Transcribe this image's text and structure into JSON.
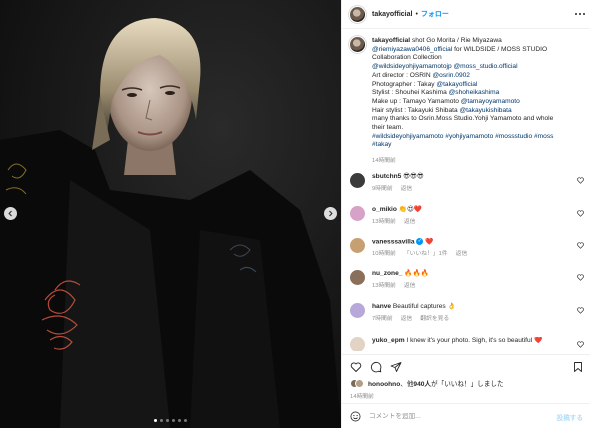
{
  "header": {
    "username": "takayofficial",
    "separator": "•",
    "follow_label": "フォロー"
  },
  "caption": {
    "username": "takayofficial",
    "lines": [
      "shot Go Morita / Rie Miyazawa",
      "@riemiyazawa0406_official",
      " for WILDSIDE / MOSS STUDIO",
      "Collaboration Collection",
      "@wildsideyohjiyamamotojp @moss_studio.official",
      "Art director : OSRIN ",
      "@osrin.0902",
      "Photographer : Takay ",
      "@takayofficial",
      "Stylist : Shouhei Kashima ",
      "@shoheikashima",
      "Make up : Tamayo Yamamoto ",
      "@tamayoyamamoto",
      "Hair stylist : Takayuki Shibata ",
      "@takayukishibata",
      "many thanks to Osrin.Moss Studio.Yohji Yamamoto and whole",
      "their team.",
      "#wildsideyohjiyamamoto #yohjiyamamoto #mossstudio #moss",
      "#takay"
    ],
    "time": "14時間前"
  },
  "comments": [
    {
      "username": "sbutchn5",
      "text": "😎😎😎",
      "time": "9時間前",
      "reply": "返信",
      "likes": "",
      "translate": "",
      "avatar_color": "#3b3b3b"
    },
    {
      "username": "o_mikio",
      "text": "👏😍❤️",
      "time": "13時間前",
      "reply": "返信",
      "likes": "",
      "translate": "",
      "avatar_color": "#d6a2c8"
    },
    {
      "username": "vanesssavilla",
      "text": "❤️",
      "time": "10時間前",
      "reply": "返信",
      "likes": "「いいね！」1件",
      "translate": "",
      "avatar_color": "#c7a072",
      "verified": "✓"
    },
    {
      "username": "nu_zone_",
      "text": "🔥🔥🔥",
      "time": "13時間前",
      "reply": "返信",
      "likes": "",
      "translate": "",
      "avatar_color": "#8a6f5a"
    },
    {
      "username": "hanve",
      "text": "Beautiful captures 👌",
      "time": "7時間前",
      "reply": "返信",
      "likes": "",
      "translate": "翻訳を見る",
      "avatar_color": "#b8a7d9"
    },
    {
      "username": "yuko_epm",
      "text": "I knew it's your photo. Sigh, it's so beautiful ❤️",
      "time": "",
      "reply": "",
      "likes": "",
      "translate": "",
      "avatar_color": "#e2d3c4"
    }
  ],
  "likes": {
    "user": "honoohno",
    "middle": "、他",
    "count": "940人",
    "suffix": "が「いいね！」しました"
  },
  "post_time": "14時間前",
  "add_comment": {
    "placeholder": "コメントを追加...",
    "post_label": "投稿する"
  },
  "icons": {
    "prev": "chevron-left-icon",
    "next": "chevron-right-icon",
    "more": "more-horizontal-icon",
    "like": "heart-icon",
    "comment": "comment-icon",
    "share": "share-icon",
    "save": "bookmark-icon",
    "emoji": "emoji-icon"
  },
  "carousel": {
    "dots": 6,
    "active_index": 0
  },
  "colors": {
    "link": "#00376b",
    "follow": "#0095f6",
    "post_button": "#b2dffc",
    "muted": "#8e8e8e"
  }
}
